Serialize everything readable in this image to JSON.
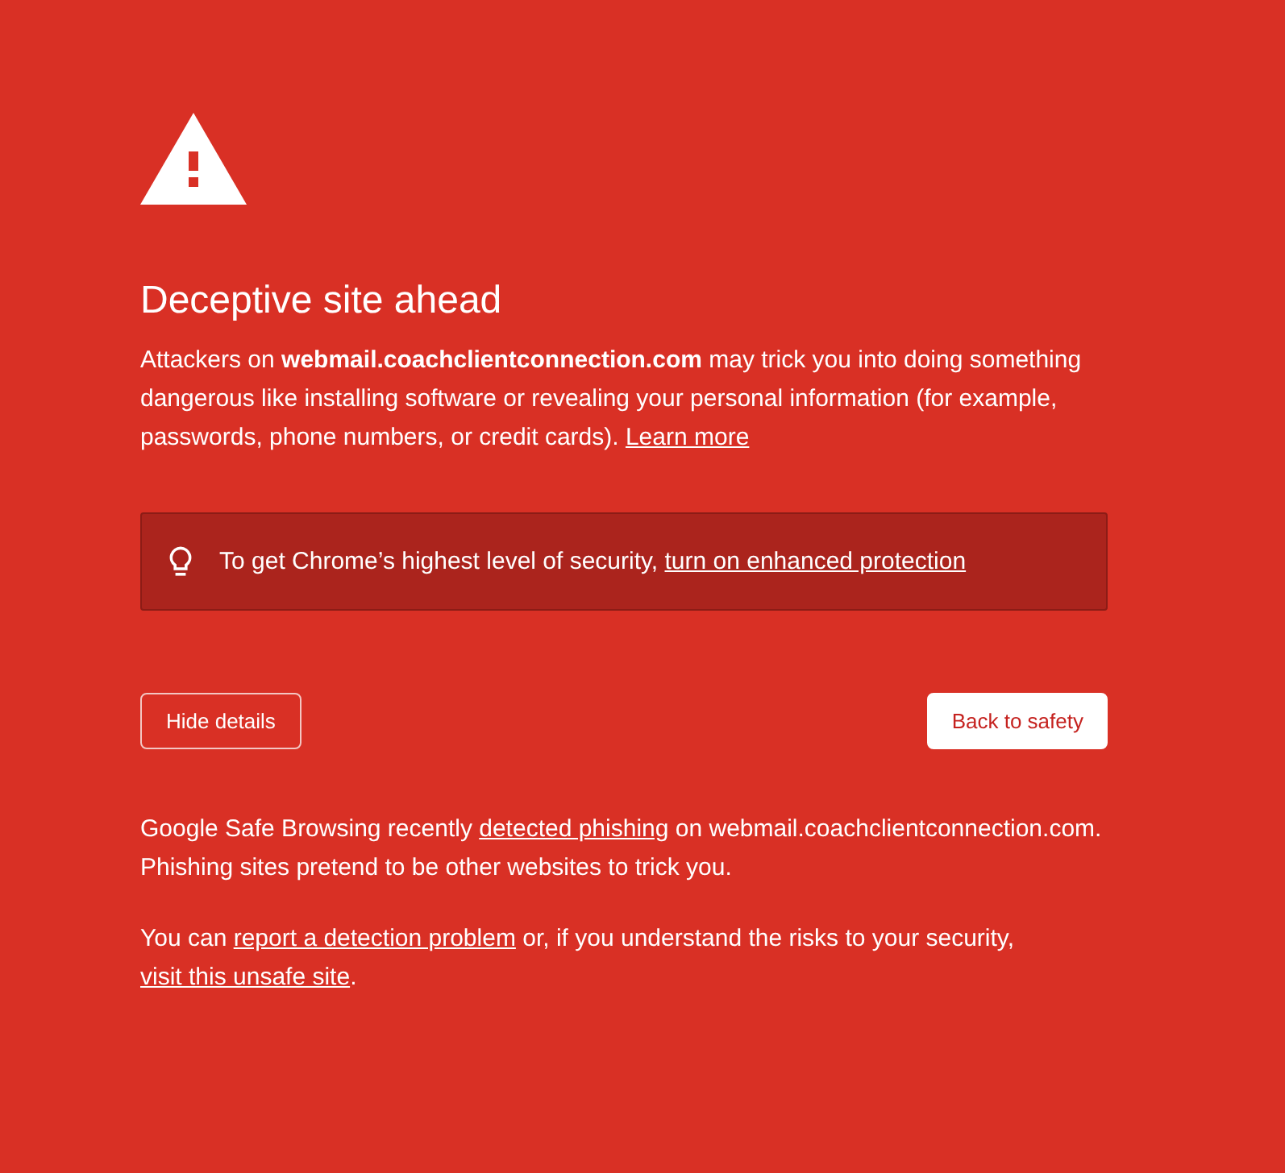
{
  "heading": "Deceptive site ahead",
  "intro": [
    {
      "kind": "text",
      "text": "Attackers on **webmail.coachclientconnection.com** may trick you into doing something dangerous like installing software or revealing your personal information (for example, passwords, phone numbers, or credit cards). "
    },
    {
      "kind": "link",
      "text": "Learn more"
    }
  ],
  "notice": [
    {
      "kind": "text",
      "text": "To get Chrome’s highest level of security, "
    },
    {
      "kind": "link",
      "text": "turn on enhanced protection"
    }
  ],
  "buttons": {
    "details": "Hide details",
    "primary": "Back to safety"
  },
  "details": [
    [
      {
        "kind": "text",
        "text": "Google Safe Browsing recently "
      },
      {
        "kind": "link",
        "text": "detected phishing"
      },
      {
        "kind": "text",
        "text": " on webmail.coachclientconnection.com. Phishing sites pretend to be other websites to trick you."
      }
    ],
    [
      {
        "kind": "text",
        "text": "You can "
      },
      {
        "kind": "link",
        "text": "report a detection problem"
      },
      {
        "kind": "text",
        "text": " or, if you understand the risks to your security, "
      },
      {
        "kind": "link",
        "text": "visit this unsafe site"
      },
      {
        "kind": "text",
        "text": "."
      }
    ]
  ]
}
